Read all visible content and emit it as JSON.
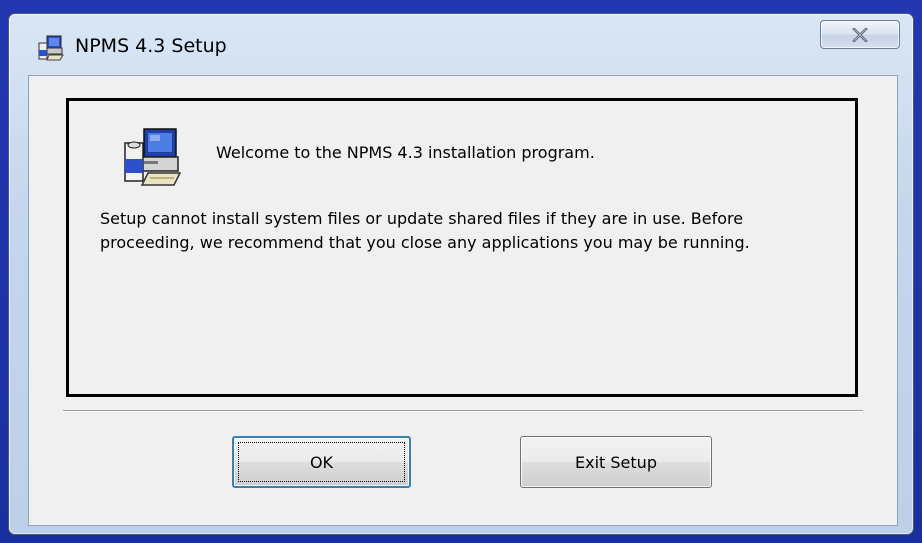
{
  "window": {
    "title": "NPMS 4.3 Setup",
    "title_icon": "setup-computer-icon",
    "close_icon": "close-x-icon"
  },
  "content": {
    "icon": "setup-computer-icon",
    "welcome": "Welcome to the NPMS 4.3 installation program.",
    "message": "Setup cannot install system files or update shared files if they are in use. Before proceeding, we recommend that you close any applications you may be running."
  },
  "buttons": {
    "ok_label": "OK",
    "exit_label": "Exit Setup"
  },
  "colors": {
    "desktop": "#1f34a6",
    "frame": "#c4d6ec",
    "client": "#f0f0f0",
    "focus_border": "#3c7fb1"
  }
}
